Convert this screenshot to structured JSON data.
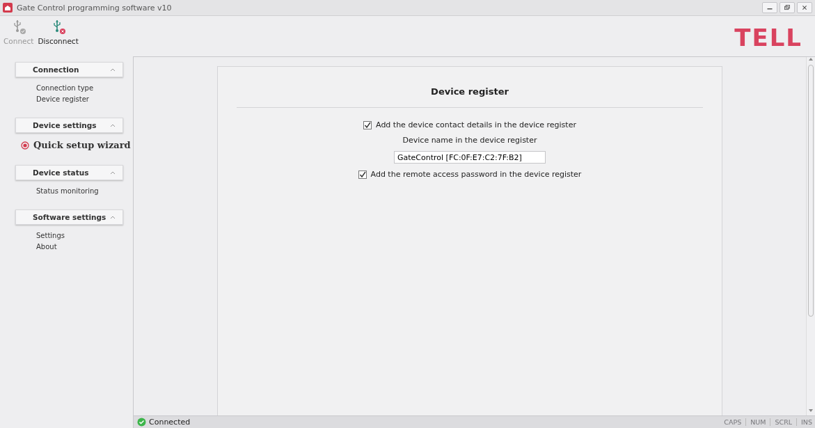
{
  "window": {
    "title": "Gate Control programming software v10"
  },
  "toolbar": [
    {
      "label": "Connect",
      "kind": "connect",
      "disabled": true
    },
    {
      "label": "Disconnect",
      "kind": "disconnect",
      "disabled": false
    }
  ],
  "logo": "TELL",
  "sidebar": {
    "sections": [
      {
        "title": "Connection",
        "expanded": true,
        "items": [
          {
            "label": "Connection type",
            "selected": false
          },
          {
            "label": "Device register",
            "selected": false
          }
        ]
      },
      {
        "title": "Device settings",
        "expanded": true,
        "items": [
          {
            "label": "Quick setup wizard",
            "selected": true
          }
        ]
      },
      {
        "title": "Device status",
        "expanded": true,
        "items": [
          {
            "label": "Status monitoring",
            "selected": false
          }
        ]
      },
      {
        "title": "Software settings",
        "expanded": true,
        "items": [
          {
            "label": "Settings",
            "selected": false
          },
          {
            "label": "About",
            "selected": false
          }
        ]
      }
    ]
  },
  "panel": {
    "title": "Device register",
    "options": [
      {
        "kind": "checkbox",
        "label": "Add the device contact details in the device register",
        "checked": true
      },
      {
        "kind": "field",
        "label": "Device name in the device register",
        "value": "GateControl [FC:0F:E7:C2:7F:B2]"
      },
      {
        "kind": "checkbox",
        "label": "Add the remote access password in the device register",
        "checked": true
      }
    ]
  },
  "status_bar": {
    "status": "Connected",
    "indicators": [
      {
        "label": "CAPS",
        "on": false
      },
      {
        "label": "NUM",
        "on": false
      },
      {
        "label": "SCRL",
        "on": false
      },
      {
        "label": "INS",
        "on": false
      }
    ]
  }
}
